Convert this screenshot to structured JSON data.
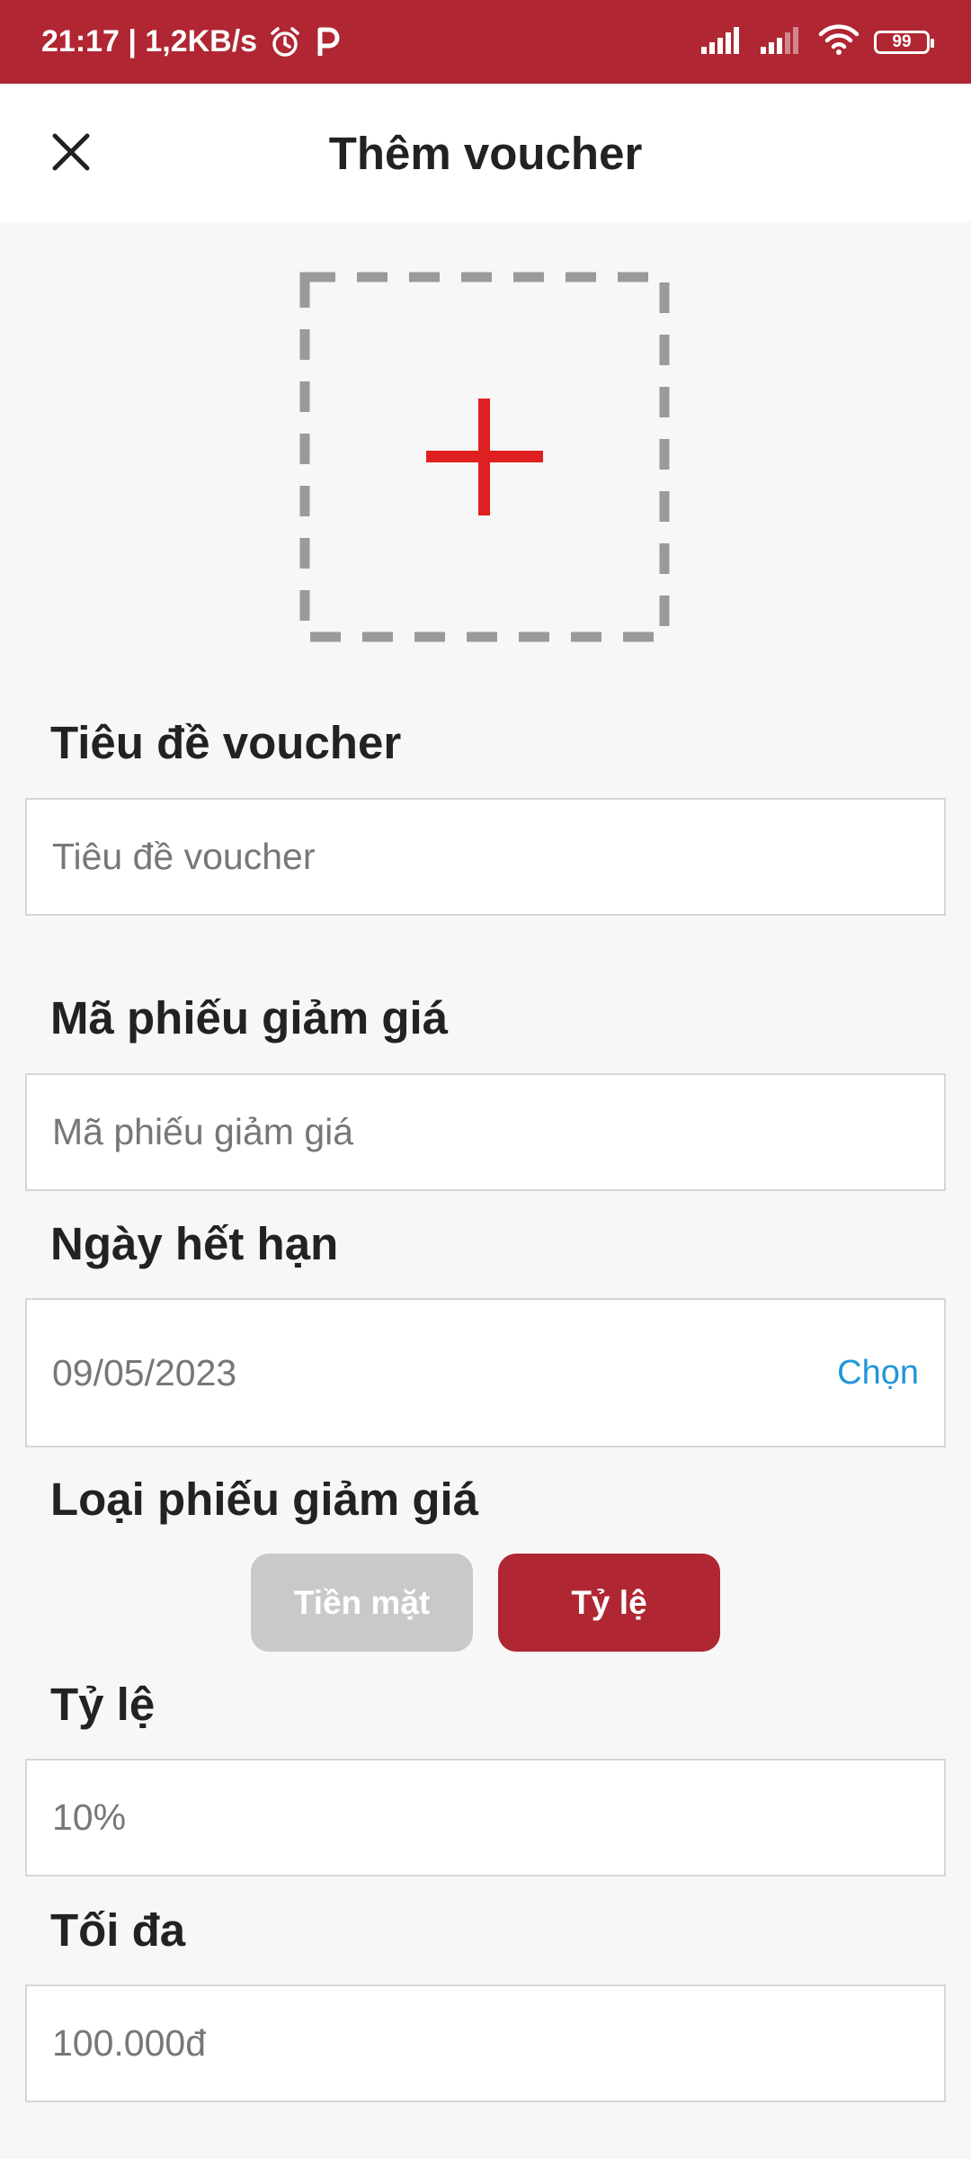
{
  "status_bar": {
    "time_speed": "21:17 | 1,2KB/s",
    "battery": "99"
  },
  "header": {
    "title": "Thêm voucher"
  },
  "form": {
    "title_label": "Tiêu đề voucher",
    "title_placeholder": "Tiêu đề voucher",
    "code_label": "Mã phiếu giảm giá",
    "code_placeholder": "Mã phiếu giảm giá",
    "expiry_label": "Ngày hết hạn",
    "expiry_value": "09/05/2023",
    "expiry_choose": "Chọn",
    "type_label": "Loại phiếu giảm giá",
    "type_options": [
      "Tiền mặt",
      "Tỷ lệ"
    ],
    "type_selected": "Tỷ lệ",
    "rate_label": "Tỷ lệ",
    "rate_value": "10%",
    "max_label": "Tối đa",
    "max_value": "100.000đ"
  },
  "colors": {
    "brand": "#b02632",
    "accent_plus": "#e02020",
    "link": "#2196d9",
    "inactive": "#c9c9c9"
  },
  "icons": [
    "alarm-icon",
    "p-app-icon",
    "signal-icon",
    "wifi-icon",
    "battery-icon",
    "close-icon",
    "add-image-icon"
  ]
}
